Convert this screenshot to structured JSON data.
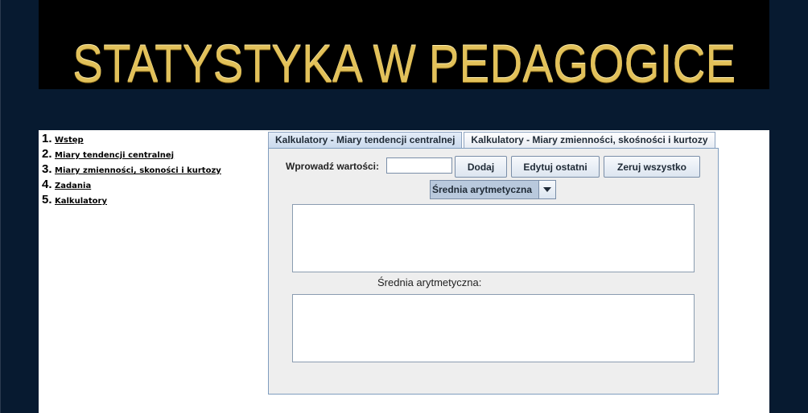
{
  "banner": {
    "title": "STATYSTYKA W PEDAGOGICE"
  },
  "nav": {
    "items": [
      {
        "num": "1.",
        "label": "Wstęp"
      },
      {
        "num": "2.",
        "label": "Miary tendencji centralnej"
      },
      {
        "num": "3.",
        "label": "Miary zmienności, skoności i kurtozy"
      },
      {
        "num": "4.",
        "label": "Zadania"
      },
      {
        "num": "5.",
        "label": "Kalkulatory"
      }
    ]
  },
  "tabs": [
    {
      "label": "Kalkulatory - Miary tendencji centralnej",
      "active": true
    },
    {
      "label": "Kalkulatory - Miary zmienności, skośności i kurtozy",
      "active": false
    }
  ],
  "calculator": {
    "input_label": "Wprowadź wartości:",
    "input_value": "",
    "add_label": "Dodaj",
    "edit_last_label": "Edytuj ostatni",
    "reset_all_label": "Zeruj wszystko",
    "select_value": "Średnia arytmetyczna",
    "values_text": "",
    "result_label": "Średnia arytmetyczna:",
    "result_text": ""
  },
  "colors": {
    "background": "#071a30",
    "banner_gold": "#e2c15a",
    "tab_border": "#8da3bf"
  }
}
